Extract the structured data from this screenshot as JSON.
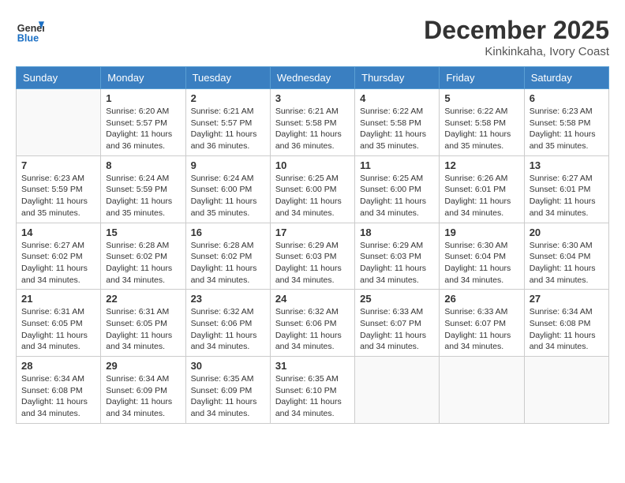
{
  "header": {
    "logo": {
      "general": "General",
      "blue": "Blue"
    },
    "title": "December 2025",
    "location": "Kinkinkaha, Ivory Coast"
  },
  "calendar": {
    "days_of_week": [
      "Sunday",
      "Monday",
      "Tuesday",
      "Wednesday",
      "Thursday",
      "Friday",
      "Saturday"
    ],
    "weeks": [
      [
        {
          "day": "",
          "empty": true
        },
        {
          "day": "1",
          "sunrise": "6:20 AM",
          "sunset": "5:57 PM",
          "daylight": "11 hours and 36 minutes."
        },
        {
          "day": "2",
          "sunrise": "6:21 AM",
          "sunset": "5:57 PM",
          "daylight": "11 hours and 36 minutes."
        },
        {
          "day": "3",
          "sunrise": "6:21 AM",
          "sunset": "5:58 PM",
          "daylight": "11 hours and 36 minutes."
        },
        {
          "day": "4",
          "sunrise": "6:22 AM",
          "sunset": "5:58 PM",
          "daylight": "11 hours and 35 minutes."
        },
        {
          "day": "5",
          "sunrise": "6:22 AM",
          "sunset": "5:58 PM",
          "daylight": "11 hours and 35 minutes."
        },
        {
          "day": "6",
          "sunrise": "6:23 AM",
          "sunset": "5:58 PM",
          "daylight": "11 hours and 35 minutes."
        }
      ],
      [
        {
          "day": "7",
          "sunrise": "6:23 AM",
          "sunset": "5:59 PM",
          "daylight": "11 hours and 35 minutes."
        },
        {
          "day": "8",
          "sunrise": "6:24 AM",
          "sunset": "5:59 PM",
          "daylight": "11 hours and 35 minutes."
        },
        {
          "day": "9",
          "sunrise": "6:24 AM",
          "sunset": "6:00 PM",
          "daylight": "11 hours and 35 minutes."
        },
        {
          "day": "10",
          "sunrise": "6:25 AM",
          "sunset": "6:00 PM",
          "daylight": "11 hours and 34 minutes."
        },
        {
          "day": "11",
          "sunrise": "6:25 AM",
          "sunset": "6:00 PM",
          "daylight": "11 hours and 34 minutes."
        },
        {
          "day": "12",
          "sunrise": "6:26 AM",
          "sunset": "6:01 PM",
          "daylight": "11 hours and 34 minutes."
        },
        {
          "day": "13",
          "sunrise": "6:27 AM",
          "sunset": "6:01 PM",
          "daylight": "11 hours and 34 minutes."
        }
      ],
      [
        {
          "day": "14",
          "sunrise": "6:27 AM",
          "sunset": "6:02 PM",
          "daylight": "11 hours and 34 minutes."
        },
        {
          "day": "15",
          "sunrise": "6:28 AM",
          "sunset": "6:02 PM",
          "daylight": "11 hours and 34 minutes."
        },
        {
          "day": "16",
          "sunrise": "6:28 AM",
          "sunset": "6:02 PM",
          "daylight": "11 hours and 34 minutes."
        },
        {
          "day": "17",
          "sunrise": "6:29 AM",
          "sunset": "6:03 PM",
          "daylight": "11 hours and 34 minutes."
        },
        {
          "day": "18",
          "sunrise": "6:29 AM",
          "sunset": "6:03 PM",
          "daylight": "11 hours and 34 minutes."
        },
        {
          "day": "19",
          "sunrise": "6:30 AM",
          "sunset": "6:04 PM",
          "daylight": "11 hours and 34 minutes."
        },
        {
          "day": "20",
          "sunrise": "6:30 AM",
          "sunset": "6:04 PM",
          "daylight": "11 hours and 34 minutes."
        }
      ],
      [
        {
          "day": "21",
          "sunrise": "6:31 AM",
          "sunset": "6:05 PM",
          "daylight": "11 hours and 34 minutes."
        },
        {
          "day": "22",
          "sunrise": "6:31 AM",
          "sunset": "6:05 PM",
          "daylight": "11 hours and 34 minutes."
        },
        {
          "day": "23",
          "sunrise": "6:32 AM",
          "sunset": "6:06 PM",
          "daylight": "11 hours and 34 minutes."
        },
        {
          "day": "24",
          "sunrise": "6:32 AM",
          "sunset": "6:06 PM",
          "daylight": "11 hours and 34 minutes."
        },
        {
          "day": "25",
          "sunrise": "6:33 AM",
          "sunset": "6:07 PM",
          "daylight": "11 hours and 34 minutes."
        },
        {
          "day": "26",
          "sunrise": "6:33 AM",
          "sunset": "6:07 PM",
          "daylight": "11 hours and 34 minutes."
        },
        {
          "day": "27",
          "sunrise": "6:34 AM",
          "sunset": "6:08 PM",
          "daylight": "11 hours and 34 minutes."
        }
      ],
      [
        {
          "day": "28",
          "sunrise": "6:34 AM",
          "sunset": "6:08 PM",
          "daylight": "11 hours and 34 minutes."
        },
        {
          "day": "29",
          "sunrise": "6:34 AM",
          "sunset": "6:09 PM",
          "daylight": "11 hours and 34 minutes."
        },
        {
          "day": "30",
          "sunrise": "6:35 AM",
          "sunset": "6:09 PM",
          "daylight": "11 hours and 34 minutes."
        },
        {
          "day": "31",
          "sunrise": "6:35 AM",
          "sunset": "6:10 PM",
          "daylight": "11 hours and 34 minutes."
        },
        {
          "day": "",
          "empty": true
        },
        {
          "day": "",
          "empty": true
        },
        {
          "day": "",
          "empty": true
        }
      ]
    ]
  }
}
